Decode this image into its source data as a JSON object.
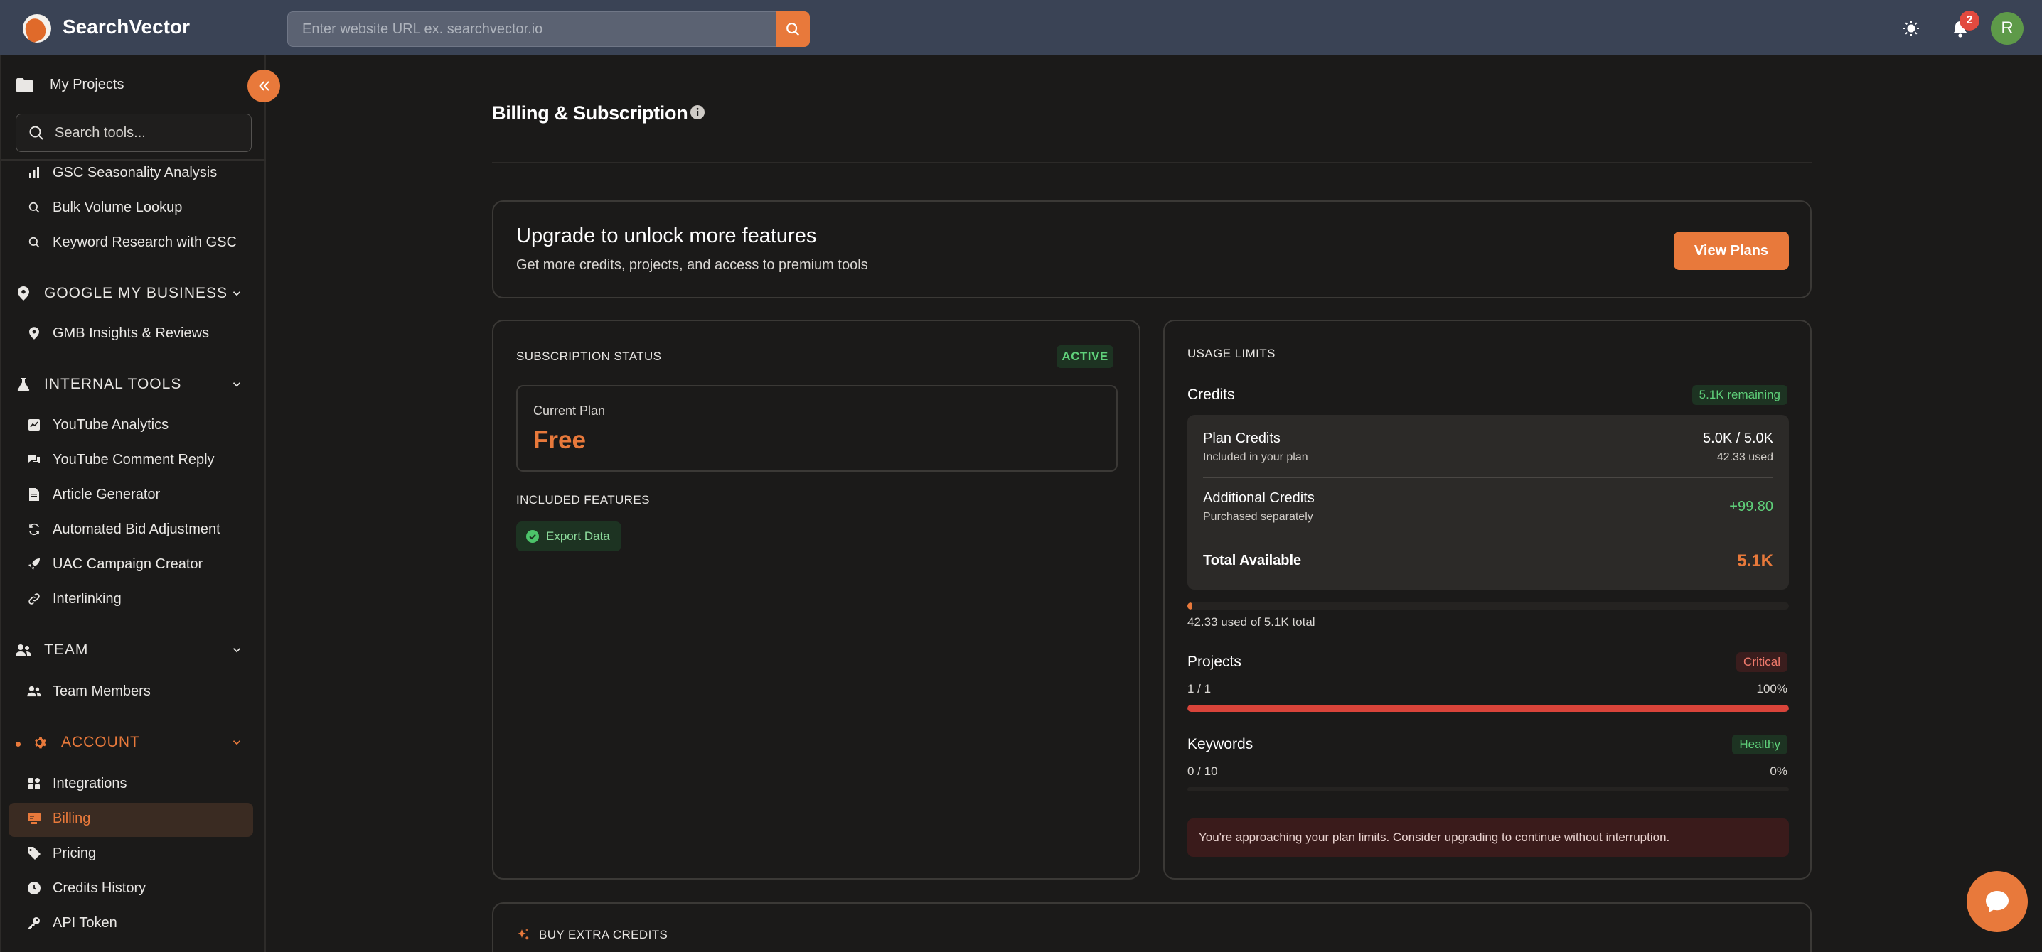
{
  "app": {
    "name": "SearchVector",
    "url_placeholder": "Enter website URL ex. searchvector.io",
    "notification_count": "2",
    "avatar_initial": "R"
  },
  "sidebar": {
    "projects_label": "My Projects",
    "search_placeholder": "Search tools...",
    "items_top": [
      "GSC Seasonality Analysis",
      "Bulk Volume Lookup",
      "Keyword Research with GSC"
    ],
    "sections": {
      "gmb": {
        "title": "GOOGLE MY BUSINESS",
        "items": [
          "GMB Insights & Reviews"
        ]
      },
      "internal": {
        "title": "INTERNAL TOOLS",
        "items": [
          "YouTube Analytics",
          "YouTube Comment Reply",
          "Article Generator",
          "Automated Bid Adjustment",
          "UAC Campaign Creator",
          "Interlinking"
        ]
      },
      "team": {
        "title": "TEAM",
        "items": [
          "Team Members"
        ]
      },
      "account": {
        "title": "ACCOUNT",
        "items": [
          "Integrations",
          "Billing",
          "Pricing",
          "Credits History",
          "API Token"
        ]
      }
    }
  },
  "page": {
    "title": "Billing & Subscription"
  },
  "upgrade": {
    "title": "Upgrade to unlock more features",
    "subtitle": "Get more credits, projects, and access to premium tools",
    "button": "View Plans"
  },
  "subscription": {
    "status_label": "SUBSCRIPTION STATUS",
    "status_badge": "ACTIVE",
    "current_plan_label": "Current Plan",
    "current_plan": "Free",
    "included_label": "INCLUDED FEATURES",
    "features": [
      "Export Data"
    ]
  },
  "usage": {
    "title": "USAGE LIMITS",
    "credits": {
      "label": "Credits",
      "remaining": "5.1K remaining",
      "plan_credits_label": "Plan Credits",
      "plan_credits_sub": "Included in your plan",
      "plan_credits_value": "5.0K / 5.0K",
      "plan_credits_used": "42.33 used",
      "additional_label": "Additional Credits",
      "additional_sub": "Purchased separately",
      "additional_value": "+99.80",
      "total_label": "Total Available",
      "total_value": "5.1K",
      "usage_text": "42.33 used of 5.1K total",
      "used_fraction": 0.008
    },
    "projects": {
      "label": "Projects",
      "status": "Critical",
      "count": "1 / 1",
      "percent": "100%",
      "fraction": 1.0
    },
    "keywords": {
      "label": "Keywords",
      "status": "Healthy",
      "count": "0 / 10",
      "percent": "0%",
      "fraction": 0
    },
    "warning": "You're approaching your plan limits. Consider upgrading to continue without interruption."
  },
  "buy": {
    "title": "BUY EXTRA CREDITS"
  },
  "colors": {
    "accent": "#e8793b",
    "critical": "#d9443a",
    "healthy": "#5fd07a"
  }
}
